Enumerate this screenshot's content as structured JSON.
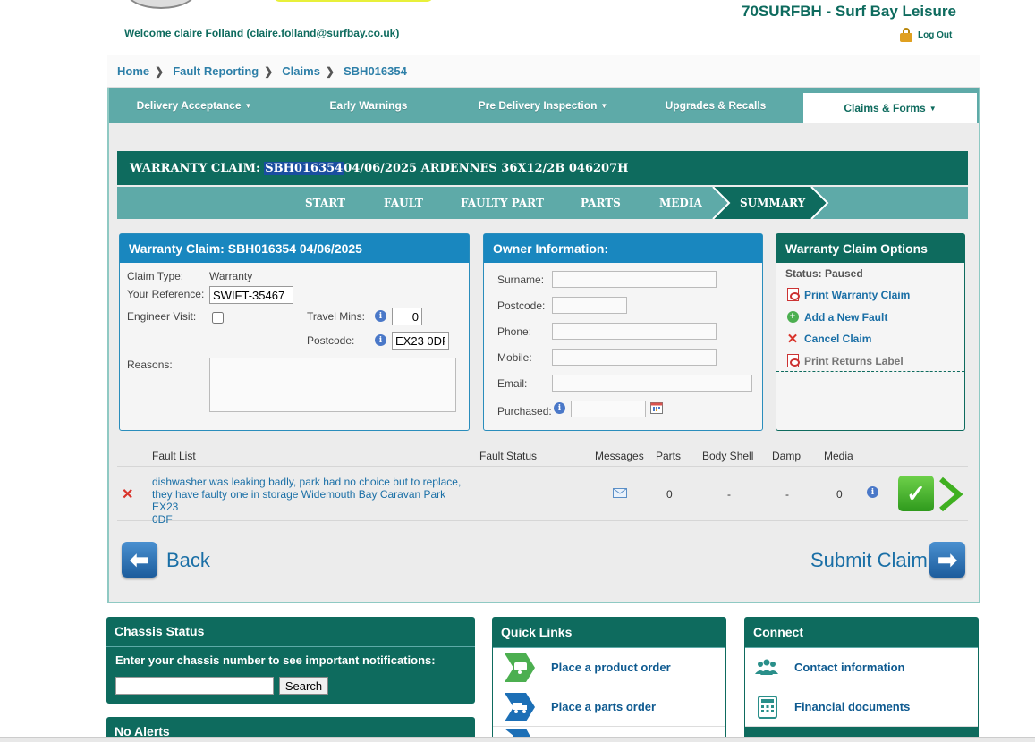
{
  "header": {
    "dealer": "70SURFBH - Surf Bay Leisure",
    "welcome": "Welcome claire Folland (claire.folland@surfbay.co.uk)",
    "logout": "Log Out"
  },
  "breadcrumb": [
    "Home",
    "Fault Reporting",
    "Claims",
    "SBH016354"
  ],
  "nav": {
    "tabs": [
      {
        "label": "Delivery Acceptance",
        "caret": "▼"
      },
      {
        "label": "Early Warnings",
        "caret": ""
      },
      {
        "label": "Pre Delivery Inspection",
        "caret": "▼"
      },
      {
        "label": "Upgrades & Recalls",
        "caret": ""
      },
      {
        "label": "Claims & Forms",
        "caret": "▼"
      }
    ]
  },
  "claim_bar": {
    "prefix": "WARRANTY CLAIM: ",
    "claim_no": "SBH016354",
    "rest": " 04/06/2025 ARDENNES 36X12/2B 046207H"
  },
  "steps": [
    "START",
    "FAULT",
    "FAULTY PART",
    "PARTS",
    "MEDIA",
    "SUMMARY"
  ],
  "claim_panel": {
    "title": "Warranty Claim: SBH016354 04/06/2025",
    "claim_type_label": "Claim Type:",
    "claim_type": "Warranty",
    "reference_label": "Your Reference:",
    "reference": "SWIFT-35467",
    "engineer_label": "Engineer Visit:",
    "travel_label": "Travel Mins:",
    "travel_mins": "0",
    "postcode_label": "Postcode:",
    "postcode": "EX23 0DF",
    "reasons_label": "Reasons:",
    "reasons": ""
  },
  "owner_panel": {
    "title": "Owner Information:",
    "fields": [
      {
        "label": "Surname:",
        "value": ""
      },
      {
        "label": "Postcode:",
        "value": ""
      },
      {
        "label": "Phone:",
        "value": ""
      },
      {
        "label": "Mobile:",
        "value": ""
      },
      {
        "label": "Email:",
        "value": ""
      },
      {
        "label": "Purchased:",
        "value": ""
      }
    ]
  },
  "options_panel": {
    "title": "Warranty Claim Options",
    "status": "Status: Paused",
    "items": [
      "Print Warranty Claim",
      "Add a New Fault",
      "Cancel Claim",
      "Print Returns Label"
    ]
  },
  "fault_table": {
    "headers": [
      "Fault List",
      "Fault Status",
      "Messages",
      "Parts",
      "Body Shell",
      "Damp",
      "Media"
    ],
    "rows": [
      {
        "description_lines": [
          "dishwasher was leaking badly, park had no choice but to replace,",
          "they have faulty one in storage Widemouth Bay Caravan Park EX23",
          "0DF"
        ],
        "status": "",
        "parts": "0",
        "body_shell": "-",
        "damp": "-",
        "media": "0"
      }
    ]
  },
  "actions": {
    "back": "Back",
    "submit": "Submit Claim"
  },
  "chassis": {
    "title": "Chassis Status",
    "prompt": "Enter your chassis number to see important notifications:",
    "input": "",
    "search": "Search"
  },
  "alerts": {
    "title": "No Alerts"
  },
  "quick_links": {
    "title": "Quick Links",
    "items": [
      "Place a product order",
      "Place a parts order"
    ]
  },
  "connect": {
    "title": "Connect",
    "items": [
      "Contact information",
      "Financial documents"
    ]
  },
  "colors": {
    "brand_green": "#0e6b5e",
    "teal": "#5eaaa8",
    "blue": "#1987bf",
    "link": "#1a6fa6"
  }
}
